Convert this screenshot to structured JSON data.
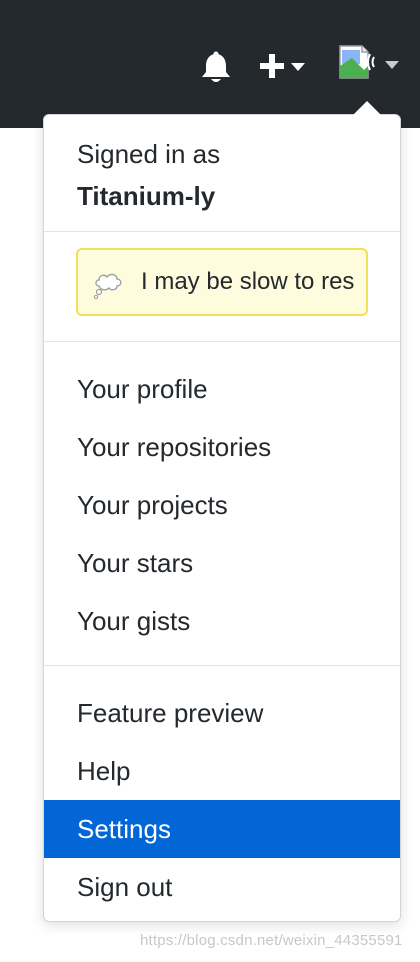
{
  "header": {
    "notifications_icon": "bell-icon",
    "create_icon": "plus-icon",
    "avatar_icon": "broken-image-icon",
    "colors": {
      "background": "#24292e",
      "icon": "#ffffff"
    }
  },
  "dropdown": {
    "signed_in_label": "Signed in as",
    "username": "Titanium-ly",
    "status": {
      "emoji_icon": "thought-balloon-icon",
      "text": "I may be slow to res"
    },
    "section1": [
      {
        "label": "Your profile"
      },
      {
        "label": "Your repositories"
      },
      {
        "label": "Your projects"
      },
      {
        "label": "Your stars"
      },
      {
        "label": "Your gists"
      }
    ],
    "section2": [
      {
        "label": "Feature preview"
      },
      {
        "label": "Help"
      },
      {
        "label": "Settings",
        "active": true
      },
      {
        "label": "Sign out"
      }
    ],
    "colors": {
      "active_bg": "#0366d6",
      "status_bg": "#fffbdd",
      "status_border": "#f1e05a"
    }
  },
  "watermark": "https://blog.csdn.net/weixin_44355591"
}
